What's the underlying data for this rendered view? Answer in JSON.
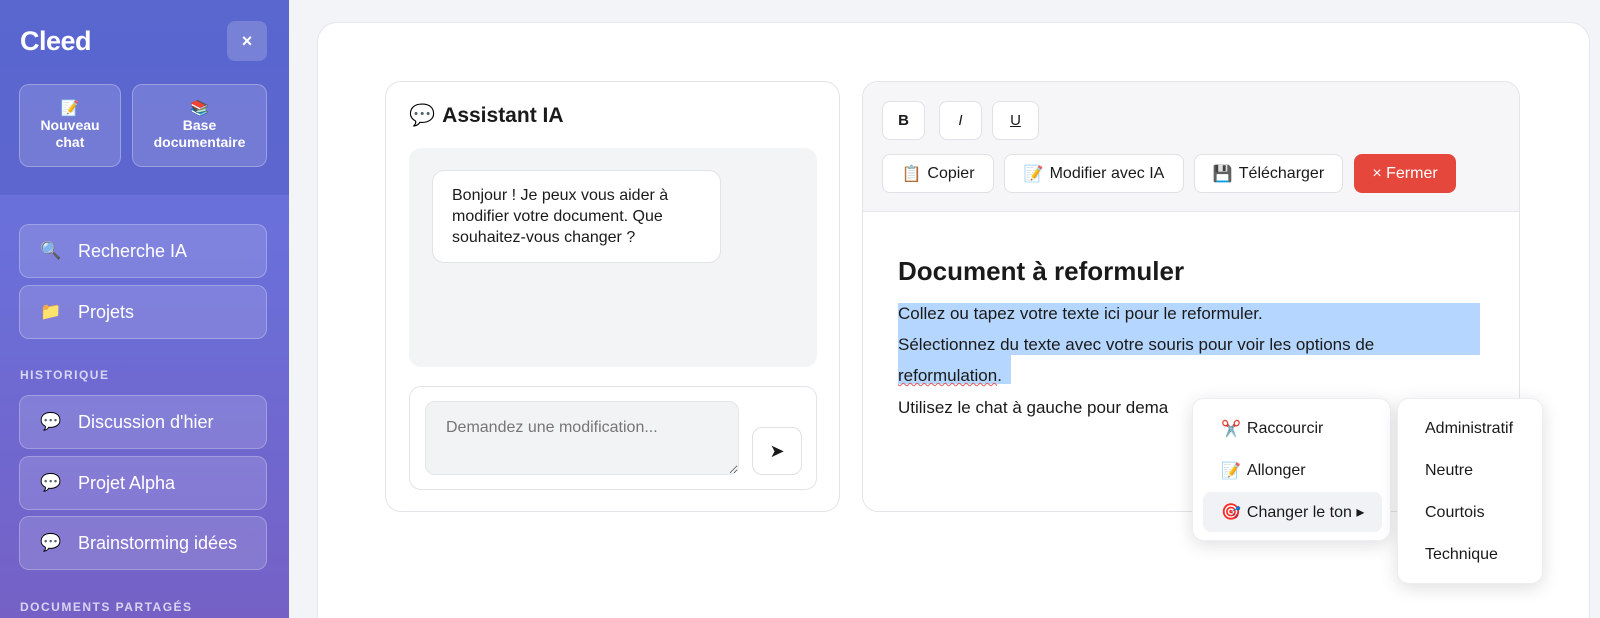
{
  "sidebar": {
    "brand": "Cleed",
    "close_label": "×",
    "quick_actions": [
      {
        "icon": "📝",
        "label": "Nouveau chat"
      },
      {
        "icon": "📚",
        "label": "Base documentaire"
      }
    ],
    "nav": [
      {
        "icon": "🔍",
        "label": "Recherche IA"
      },
      {
        "icon": "📁",
        "label": "Projets"
      }
    ],
    "history_label": "HISTORIQUE",
    "history": [
      {
        "icon": "💬",
        "label": "Discussion d'hier"
      },
      {
        "icon": "💬",
        "label": "Projet Alpha"
      },
      {
        "icon": "💬",
        "label": "Brainstorming idées"
      }
    ],
    "shared_label": "DOCUMENTS PARTAGÉS"
  },
  "assistant": {
    "icon": "💬",
    "title": "Assistant IA",
    "message": "Bonjour ! Je peux vous aider à modifier votre document. Que souhaitez-vous changer ?",
    "input_placeholder": "Demandez une modification...",
    "send_icon": "➤"
  },
  "editor": {
    "format_buttons": {
      "bold": "B",
      "italic": "I",
      "underline": "U"
    },
    "actions": {
      "copy": {
        "icon": "📋",
        "label": "Copier"
      },
      "modify_ai": {
        "icon": "📝",
        "label": "Modifier avec IA"
      },
      "download": {
        "icon": "💾",
        "label": "Télécharger"
      },
      "close": {
        "label": "× Fermer"
      }
    },
    "doc_title": "Document à reformuler",
    "line1": "Collez ou tapez votre texte ici pour le reformuler.",
    "line2": "Sélectionnez du texte avec votre souris pour voir les options de",
    "line3": "reformulation",
    "line3_end": ".",
    "line4_visible": "Utilisez le chat à gauche pour dema"
  },
  "context_menu": {
    "items": [
      {
        "icon": "✂️",
        "label": "Raccourcir"
      },
      {
        "icon": "📝",
        "label": "Allonger"
      },
      {
        "icon": "🎯",
        "label": "Changer le ton ▸"
      }
    ]
  },
  "tone_submenu": {
    "items": [
      "Administratif",
      "Neutre",
      "Courtois",
      "Technique"
    ]
  },
  "colors": {
    "sidebar_gradient_start": "#6472d8",
    "sidebar_gradient_end": "#7561c6",
    "danger": "#e5473c",
    "selection": "#b5d6ff"
  }
}
